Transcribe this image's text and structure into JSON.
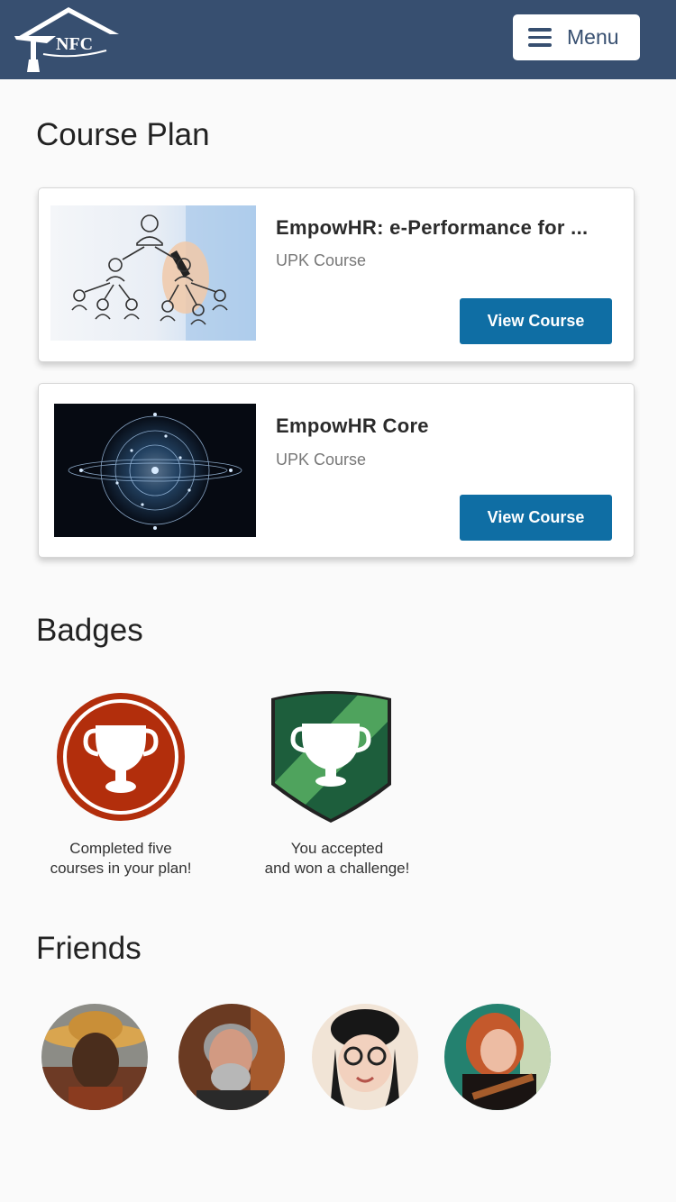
{
  "header": {
    "logo_text": "NFC",
    "menu_label": "Menu"
  },
  "course_plan": {
    "title": "Course Plan",
    "courses": [
      {
        "title": "EmpowHR: e-Performance for ...",
        "subtitle": "UPK Course",
        "button": "View Course",
        "image": "org-chart-image"
      },
      {
        "title": "EmpowHR Core",
        "subtitle": "UPK Course",
        "button": "View Course",
        "image": "network-globe-image"
      }
    ]
  },
  "badges": {
    "title": "Badges",
    "items": [
      {
        "caption_line1": "Completed five",
        "caption_line2": "courses in your plan!",
        "icon": "trophy-icon",
        "color": "#b22e0c"
      },
      {
        "caption_line1": "You accepted",
        "caption_line2": "and won a challenge!",
        "icon": "trophy-icon",
        "color": "#1d5e3c"
      }
    ]
  },
  "friends": {
    "title": "Friends",
    "avatars": [
      "avatar-friend-1",
      "avatar-friend-2",
      "avatar-friend-3",
      "avatar-friend-4"
    ]
  },
  "colors": {
    "header_bg": "#374f70",
    "button_bg": "#0f6ea4",
    "page_bg": "#fafafa"
  }
}
